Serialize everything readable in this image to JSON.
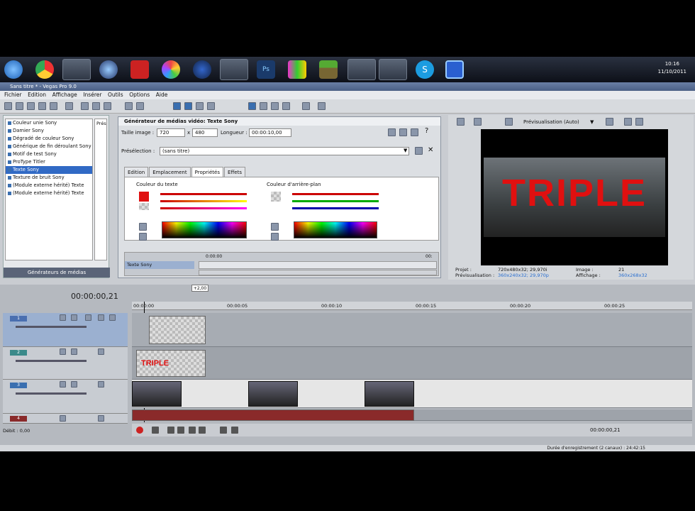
{
  "taskbar": {
    "clock_time": "10:16",
    "clock_date": "11/10/2011"
  },
  "window": {
    "title": "Sans titre * - Vegas Pro 9.0"
  },
  "menu": [
    "Fichier",
    "Edition",
    "Affichage",
    "Insérer",
    "Outils",
    "Options",
    "Aide"
  ],
  "left_panel": {
    "items": [
      "Couleur unie Sony",
      "Damier Sony",
      "Dégradé de couleur Sony",
      "Générique de fin déroulant Sony",
      "Motif de test Sony",
      "ProType Titler",
      "Texte Sony",
      "Texture de bruit Sony",
      "(Module externe hérité) Texte",
      "(Module externe hérité) Texte"
    ],
    "preset_header": "Prés",
    "footer": "Générateurs de médias"
  },
  "generator": {
    "title": "Générateur de médias vidéo: Texte Sony",
    "size_label": "Taille image :",
    "width": "720",
    "height": "480",
    "length_label": "Longueur :",
    "length_value": "00:00:10,00",
    "preset_label": "Présélection :",
    "preset_value": "(sans titre)",
    "tabs": [
      "Edition",
      "Emplacement",
      "Propriétés",
      "Effets"
    ],
    "text_color_label": "Couleur du texte",
    "bg_color_label": "Couleur d'arrière-plan",
    "timeline_name": "Texte Sony",
    "timeline_start": "0:00:00",
    "timeline_end": "00:"
  },
  "preview": {
    "mode": "Prévisualisation (Auto)",
    "title_text": "TRIPLE",
    "project_label": "Projet :",
    "project_value": "720x480x32; 29,970i",
    "preview_label": "Prévisualisation :",
    "preview_value": "360x240x32; 29,970p",
    "image_label": "Image :",
    "image_value": "21",
    "display_label": "Affichage :",
    "display_value": "360x268x32"
  },
  "timeline": {
    "timecode": "00:00:00,21",
    "rate": "+2,00",
    "ruler_marks": [
      "00:00:00",
      "00:00:05",
      "00:00:10",
      "00:00:15",
      "00:00:20",
      "00:00:25"
    ],
    "track_numbers": [
      "1",
      "2",
      "3",
      "4"
    ],
    "clip_text": "TRIPLE",
    "offset_label": "Débit : 0,00",
    "end_time": "00:00:00,21",
    "status": "Durée d'enregistrement (2 canaux) : 24:42:15"
  },
  "colors": {
    "title_red": "#e01010",
    "selection": "#316ac5",
    "audio_track": "#8a2a2a"
  }
}
